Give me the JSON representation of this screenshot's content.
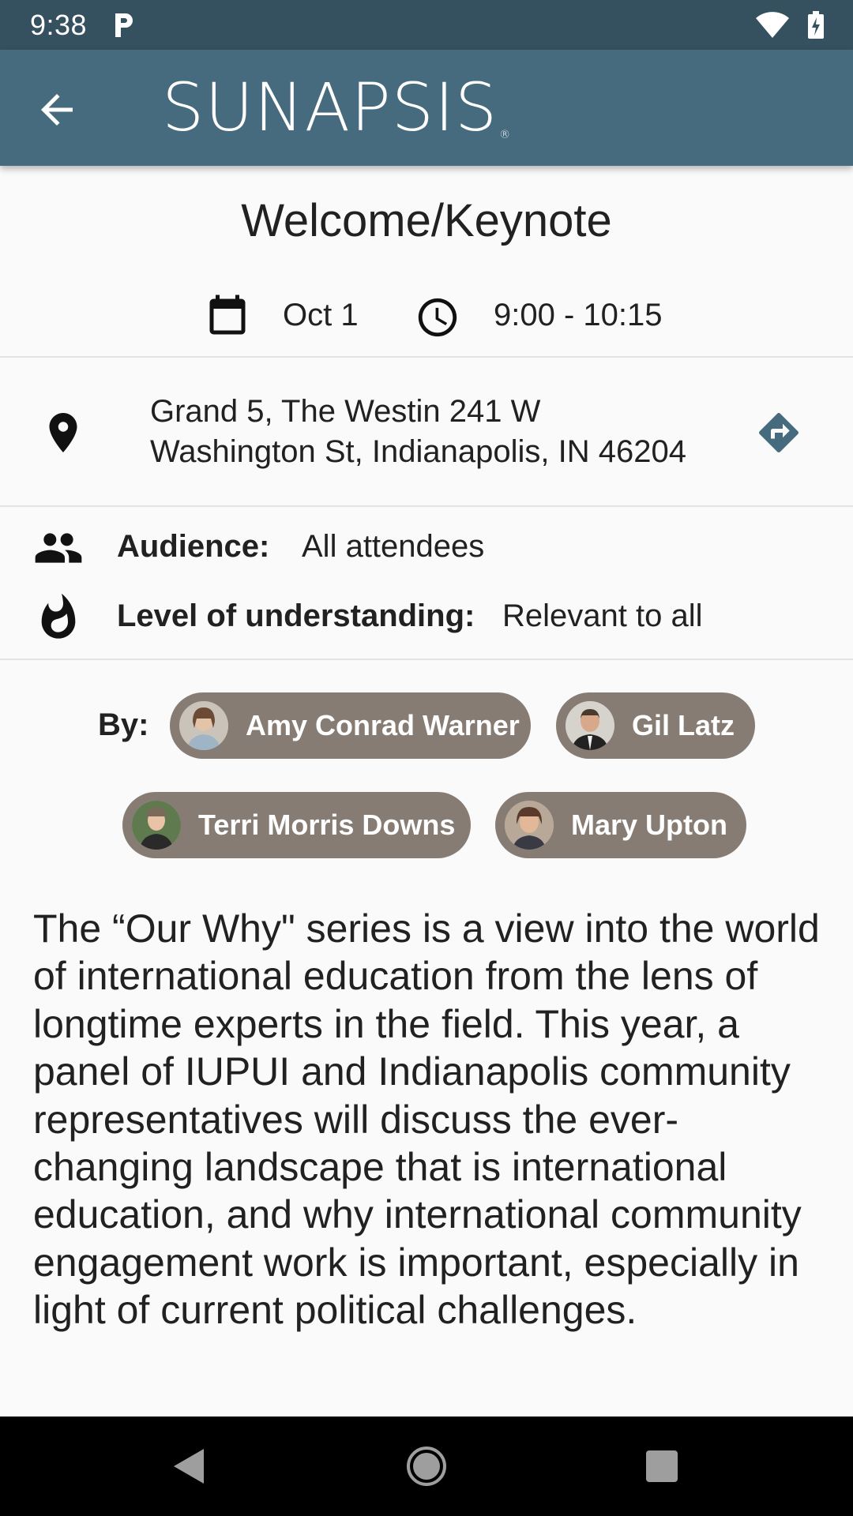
{
  "status_bar": {
    "time": "9:38",
    "notification_icon": "parking-p-icon",
    "icons": [
      "wifi-icon",
      "battery-charging-icon"
    ]
  },
  "app_bar": {
    "back_icon": "arrow-back-icon",
    "logo_text": "SUNAPSIS",
    "logo_mark": "®",
    "background": "#476b7e"
  },
  "session": {
    "title": "Welcome/Keynote",
    "date": "Oct 1",
    "time": "9:00 - 10:15",
    "address_line1": "Grand 5, The Westin 241 W",
    "address_line2": "Washington St, Indianapolis, IN 46204",
    "audience_label": "Audience:",
    "audience_value": "All attendees",
    "level_label": "Level of understanding:",
    "level_value": "Relevant to all",
    "by_label": "By:",
    "speakers": [
      {
        "name": "Amy Conrad Warner",
        "avatar": "speaker-photo-avatar"
      },
      {
        "name": "Gil Latz",
        "avatar": "speaker-photo-avatar"
      },
      {
        "name": "Terri Morris Downs",
        "avatar": "speaker-photo-avatar"
      },
      {
        "name": "Mary Upton",
        "avatar": "speaker-photo-avatar"
      }
    ],
    "description": "The “Our Why\" series is a view into the world of international education from the lens of longtime experts in the field. This year, a panel of IUPUI and Indianapolis community representatives will discuss the ever-changing landscape that is international education, and why international community engagement work is important, especially in light of current political challenges."
  },
  "colors": {
    "status_bar": "#35505f",
    "chip": "#877c74",
    "directions": "#476b7e"
  },
  "nav_bar": {
    "icons": [
      "nav-back-icon",
      "nav-home-icon",
      "nav-recents-icon"
    ]
  }
}
